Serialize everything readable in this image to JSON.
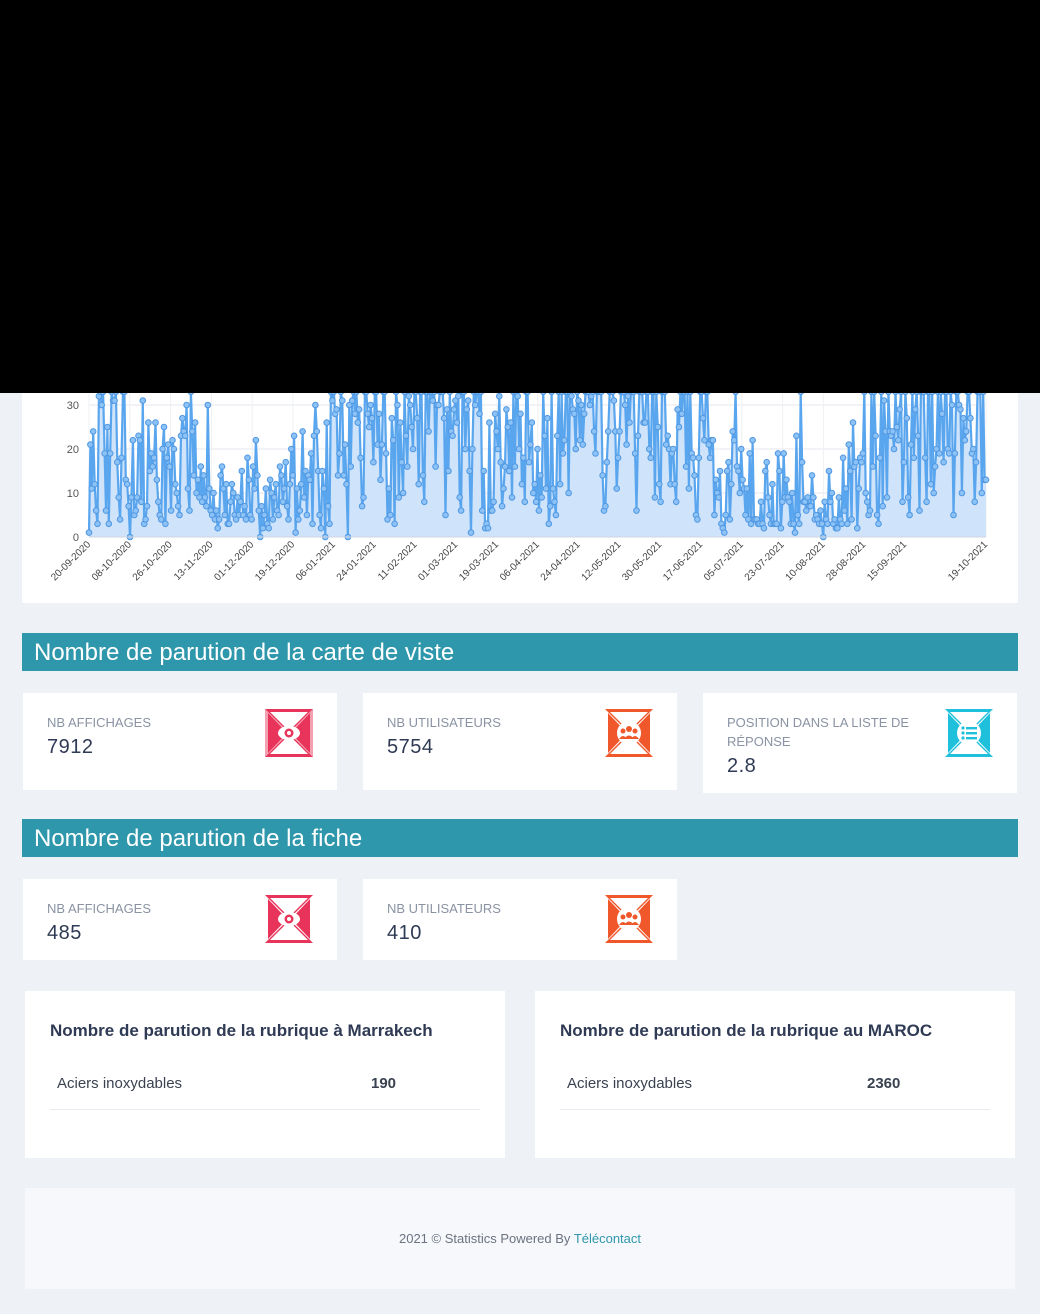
{
  "chart_data": {
    "type": "line",
    "ylim": [
      0,
      33
    ],
    "y_ticks": [
      "0",
      "10",
      "20",
      "30"
    ],
    "x_tick_labels": [
      "20-09-2020",
      "08-10-2020",
      "26-10-2020",
      "13-11-2020",
      "01-12-2020",
      "19-12-2020",
      "06-01-2021",
      "24-01-2021",
      "11-02-2021",
      "01-03-2021",
      "19-03-2021",
      "06-04-2021",
      "24-04-2021",
      "12-05-2021",
      "30-05-2021",
      "17-06-2021",
      "05-07-2021",
      "23-07-2021",
      "10-08-2021",
      "28-08-2021",
      "15-09-2021",
      "19-10-2021"
    ],
    "series": [
      {
        "values": [
          1,
          21,
          11,
          24,
          12,
          6,
          3,
          32,
          33,
          30,
          33,
          19,
          6,
          25,
          3,
          19,
          33,
          31,
          31,
          33,
          17,
          9,
          4,
          18,
          33,
          33,
          13,
          12,
          7,
          0,
          9,
          22,
          5,
          6,
          9,
          23,
          22,
          8,
          31,
          3,
          4,
          7,
          26,
          15,
          19,
          16,
          18,
          26,
          13,
          8,
          5,
          4,
          20,
          25,
          3,
          18,
          21,
          16,
          6,
          22,
          20,
          12,
          10,
          7,
          5,
          23,
          27,
          24,
          23,
          30,
          11,
          6,
          33,
          24,
          14,
          26,
          10,
          13,
          9,
          16,
          8,
          14,
          9,
          7,
          30,
          11,
          6,
          5,
          10,
          4,
          6,
          2,
          4,
          14,
          16,
          11,
          5,
          12,
          3,
          3,
          8,
          12,
          10,
          5,
          4,
          9,
          5,
          8,
          15,
          5,
          7,
          4,
          18,
          13,
          5,
          4,
          16,
          11,
          22,
          14,
          6,
          0,
          7,
          2,
          5,
          11,
          3,
          2,
          13,
          10,
          4,
          9,
          12,
          6,
          5,
          16,
          14,
          8,
          11,
          17,
          7,
          4,
          12,
          20,
          14,
          23,
          1,
          11,
          4,
          6,
          12,
          24,
          9,
          15,
          5,
          14,
          13,
          19,
          3,
          23,
          30,
          24,
          15,
          5,
          2,
          15,
          11,
          0,
          26,
          7,
          3,
          33,
          31,
          33,
          28,
          29,
          14,
          19,
          33,
          31,
          14,
          21,
          12,
          0,
          30,
          16,
          31,
          33,
          28,
          33,
          26,
          29,
          18,
          7,
          9,
          33,
          33,
          28,
          25,
          30,
          27,
          17,
          33,
          33,
          21,
          28,
          13,
          21,
          33,
          33,
          19,
          4,
          11,
          5,
          27,
          22,
          3,
          33,
          30,
          9,
          26,
          17,
          10,
          33,
          23,
          16,
          32,
          30,
          25,
          20,
          33,
          33,
          27,
          12,
          33,
          33,
          14,
          8,
          33,
          33,
          24,
          33,
          33,
          31,
          33,
          16,
          30,
          30,
          33,
          33,
          33,
          27,
          5,
          29,
          15,
          33,
          24,
          23,
          29,
          31,
          26,
          32,
          9,
          6,
          33,
          33,
          20,
          29,
          31,
          15,
          1,
          20,
          33,
          30,
          33,
          33,
          28,
          33,
          6,
          15,
          2,
          3,
          2,
          26,
          6,
          6,
          8,
          28,
          24,
          20,
          32,
          17,
          7,
          11,
          16,
          29,
          25,
          15,
          26,
          9,
          33,
          16,
          33,
          32,
          20,
          28,
          12,
          18,
          8,
          33,
          33,
          17,
          21,
          26,
          10,
          12,
          8,
          20,
          6,
          14,
          9,
          33,
          23,
          11,
          27,
          3,
          7,
          33,
          11,
          8,
          5,
          23,
          33,
          12,
          33,
          19,
          22,
          33,
          33,
          10,
          33,
          32,
          29,
          28,
          20,
          33,
          31,
          22,
          30,
          21,
          28,
          33,
          33,
          33,
          30,
          32,
          33,
          24,
          19,
          33,
          33,
          33,
          33,
          14,
          6,
          7,
          17,
          24,
          33,
          33,
          33,
          31,
          24,
          11,
          18,
          24,
          33,
          33,
          33,
          30,
          21,
          32,
          26,
          33,
          33,
          33,
          19,
          6,
          23,
          33,
          33,
          33,
          26,
          26,
          33,
          33,
          20,
          18,
          33,
          33,
          9,
          33,
          25,
          12,
          8,
          33,
          33,
          33,
          21,
          23,
          20,
          12,
          19,
          20,
          12,
          8,
          29,
          25,
          33,
          28,
          33,
          33,
          16,
          33,
          11,
          33,
          19,
          18,
          14,
          5,
          4,
          18,
          33,
          33,
          27,
          22,
          33,
          33,
          21,
          18,
          22,
          22,
          5,
          13,
          10,
          9,
          15,
          3,
          2,
          1,
          5,
          15,
          17,
          4,
          12,
          24,
          22,
          33,
          16,
          15,
          10,
          20,
          13,
          11,
          5,
          11,
          4,
          19,
          3,
          22,
          4,
          4,
          4,
          3,
          3,
          8,
          3,
          2,
          15,
          17,
          9,
          5,
          3,
          12,
          3,
          3,
          3,
          19,
          15,
          2,
          8,
          19,
          9,
          13,
          9,
          8,
          3,
          10,
          3,
          1,
          23,
          5,
          3,
          33,
          17,
          8,
          8,
          6,
          9,
          7,
          7,
          14,
          9,
          4,
          5,
          4,
          3,
          6,
          3,
          0,
          8,
          4,
          3,
          15,
          8,
          10,
          3,
          4,
          2,
          2,
          9,
          4,
          3,
          18,
          6,
          11,
          3,
          21,
          15,
          4,
          26,
          16,
          17,
          2,
          11,
          18,
          17,
          19,
          33,
          10,
          8,
          5,
          6,
          33,
          16,
          33,
          23,
          5,
          3,
          18,
          33,
          7,
          31,
          24,
          9,
          33,
          24,
          23,
          24,
          20,
          33,
          25,
          22,
          29,
          33,
          8,
          17,
          33,
          27,
          9,
          5,
          21,
          33,
          18,
          29,
          33,
          23,
          6,
          33,
          33,
          33,
          18,
          8,
          33,
          33,
          12,
          33,
          10,
          16,
          20,
          33,
          19,
          33,
          28,
          17,
          33,
          33,
          20,
          19,
          33,
          30,
          5,
          19,
          33,
          33,
          30,
          29,
          10,
          27,
          22,
          24,
          33,
          33,
          27,
          19,
          20,
          8,
          17,
          33,
          33,
          33,
          10,
          33,
          13,
          13
        ]
      }
    ]
  },
  "section1": {
    "title": "Nombre de parution de la carte de viste",
    "cards": [
      {
        "label": "NB AFFICHAGES",
        "value": "7912",
        "icon": "eye-icon",
        "color": "#e8345a"
      },
      {
        "label": "NB UTILISATEURS",
        "value": "5754",
        "icon": "users-icon",
        "color": "#f0582b"
      },
      {
        "label": "POSITION DANS LA LISTE DE RÉPONSE",
        "value": "2.8",
        "icon": "list-icon",
        "color": "#1ec0dc"
      }
    ]
  },
  "section2": {
    "title": "Nombre de parution de la fiche",
    "cards": [
      {
        "label": "NB AFFICHAGES",
        "value": "485",
        "icon": "eye-icon",
        "color": "#e8345a"
      },
      {
        "label": "NB UTILISATEURS",
        "value": "410",
        "icon": "users-icon",
        "color": "#f0582b"
      }
    ]
  },
  "tables": [
    {
      "title": "Nombre de parution de la rubrique à Marrakech",
      "rows": [
        {
          "name": "Aciers inoxydables",
          "value": "190"
        }
      ]
    },
    {
      "title": "Nombre de parution de la rubrique au MAROC",
      "rows": [
        {
          "name": "Aciers inoxydables",
          "value": "2360"
        }
      ]
    }
  ],
  "footer": {
    "text": "2021 © Statistics Powered By",
    "link": "Télécontact"
  }
}
